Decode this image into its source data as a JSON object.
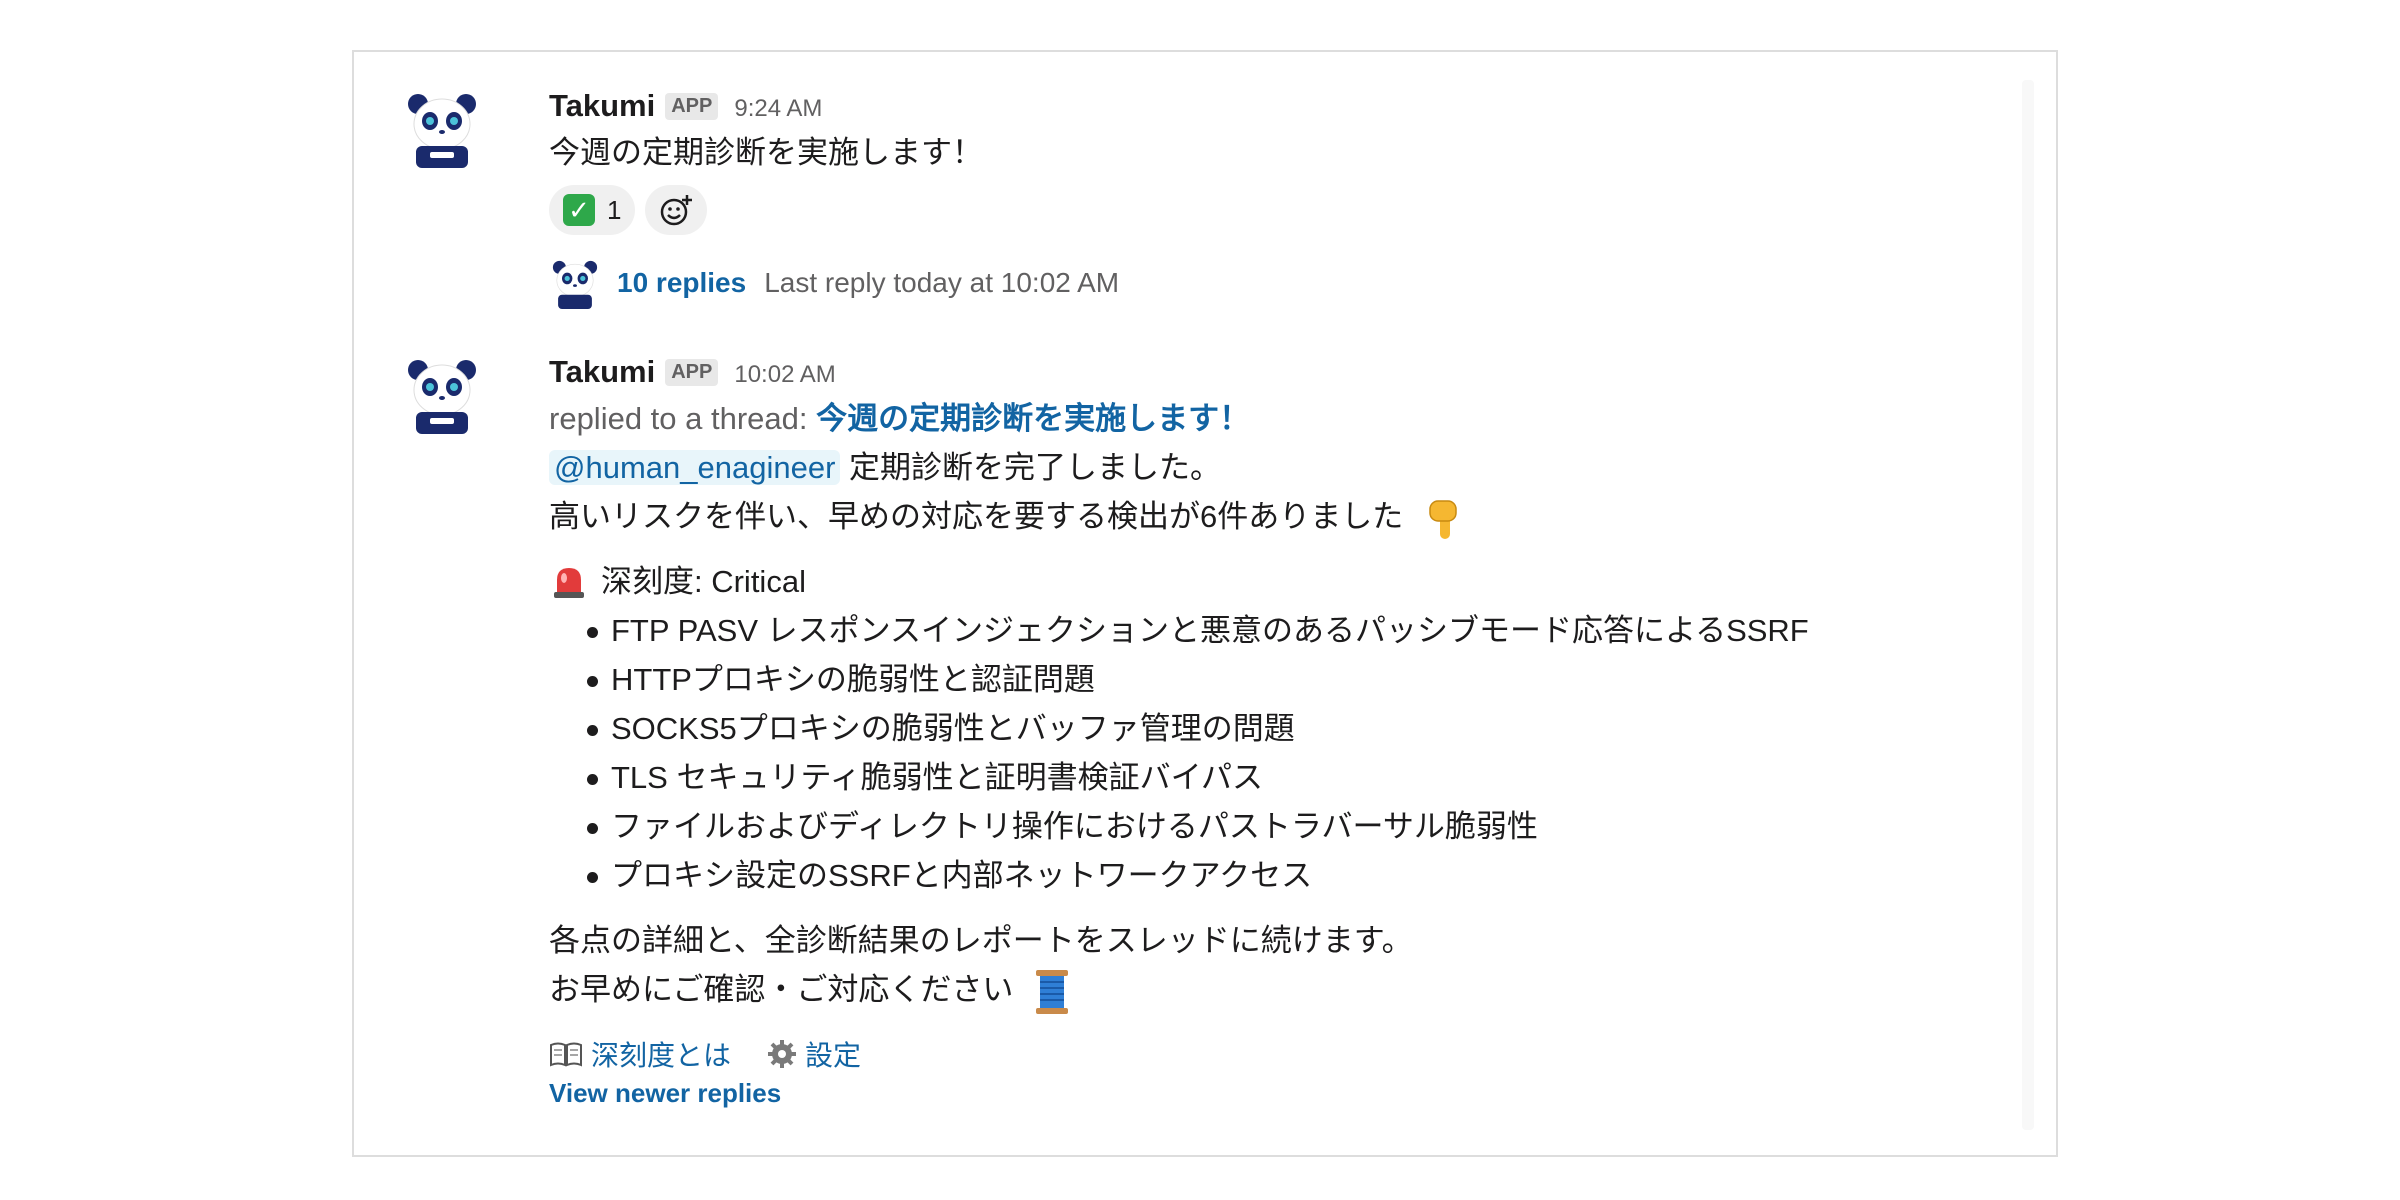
{
  "message1": {
    "author": "Takumi",
    "badge": "APP",
    "time": "9:24 AM",
    "text": "今週の定期診断を実施します！",
    "reactions": [
      {
        "emoji": "white-check-mark",
        "count": "1"
      },
      {
        "emoji": "add-reaction-icon"
      }
    ],
    "thread": {
      "replies": "10 replies",
      "last_reply": "Last reply today at 10:02 AM"
    }
  },
  "message2": {
    "author": "Takumi",
    "badge": "APP",
    "time": "10:02 AM",
    "replied_prefix": "replied to a thread:",
    "thread_title": "今週の定期診断を実施します！",
    "mention": "@human_enagineer",
    "line1_rest": "定期診断を完了しました。",
    "line2": "高いリスクを伴い、早めの対応を要する検出が6件ありました",
    "severity_label": "深刻度: Critical",
    "findings": [
      "FTP PASV レスポンスインジェクションと悪意のあるパッシブモード応答によるSSRF",
      "HTTPプロキシの脆弱性と認証問題",
      "SOCKS5プロキシの脆弱性とバッファ管理の問題",
      "TLS セキュリティ脆弱性と証明書検証バイパス",
      "ファイルおよびディレクトリ操作におけるパストラバーサル脆弱性",
      "プロキシ設定のSSRFと内部ネットワークアクセス"
    ],
    "closing1": "各点の詳細と、全診断結果のレポートをスレッドに続けます。",
    "closing2": "お早めにご確認・ご対応ください",
    "links": {
      "severity": "深刻度とは",
      "settings": "設定"
    },
    "view_newer": "View newer replies"
  },
  "colors": {
    "link": "#1264a3",
    "muted": "#616061",
    "mention_bg": "#e8f5fa",
    "panda_navy": "#1a2a6c"
  }
}
